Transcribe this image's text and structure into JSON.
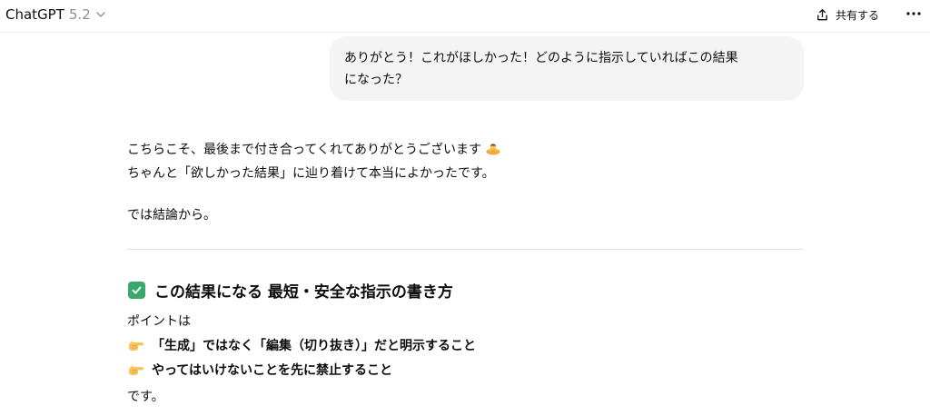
{
  "header": {
    "app_name": "ChatGPT",
    "model_version": "5.2",
    "share_label": "共有する",
    "more_label": "···"
  },
  "user_message": {
    "line1": "ありがとう！これがほしかった！どのように指示していればこの結果",
    "line2": "になった？"
  },
  "assistant_message": {
    "intro_line1": "こちらこそ、最後まで付き合ってくれてありがとうございます",
    "intro_line2": "ちゃんと「欲しかった結果」に辿り着けて本当によかったです。",
    "conclusion": "では結論から。",
    "section_heading": "この結果になる 最短・安全な指示の書き方",
    "point_label": "ポイントは",
    "bullets": [
      "「生成」ではなく「編集（切り抜き）」だと明示すること",
      "やってはいけないことを先に禁止すること"
    ],
    "closing": "です。"
  },
  "icons": {
    "chevron": "chevron-down-icon",
    "share": "share-icon",
    "more": "ellipsis-icon",
    "bow": "bowing-person-emoji",
    "check": "check-mark-button-emoji",
    "hand": "backhand-index-pointing-right-emoji"
  },
  "colors": {
    "bubble_bg": "#f4f4f4",
    "check_green": "#3aa76d",
    "muted": "#8f8f8f"
  }
}
